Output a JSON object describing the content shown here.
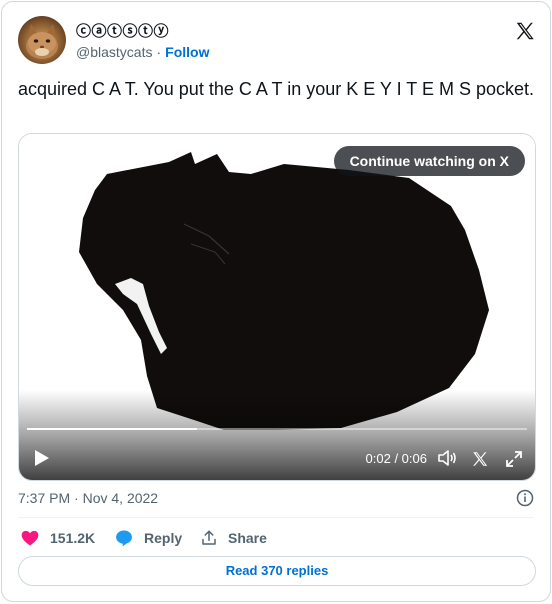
{
  "author": {
    "display_name": "ⓒⓐⓣⓢⓣⓨ",
    "handle": "@blastycats",
    "separator": "·",
    "follow_label": "Follow"
  },
  "tweet": {
    "text": "acquired C A T. You put the C A T in your K E Y  I T E M S pocket."
  },
  "video": {
    "continue_label": "Continue watching on X",
    "time_display": "0:02 / 0:06",
    "progress_fraction": 0.34
  },
  "meta": {
    "time": "7:37 PM",
    "separator": "·",
    "date": "Nov 4, 2022"
  },
  "actions": {
    "likes": "151.2K",
    "reply_label": "Reply",
    "share_label": "Share"
  },
  "read_replies_label": "Read 370 replies",
  "colors": {
    "accent": "#006fd6",
    "like": "#f91880",
    "text_primary": "#0f1419",
    "text_secondary": "#536471",
    "border": "#cfd9de"
  },
  "icons": {
    "logo": "x-logo-icon",
    "play": "play-icon",
    "volume": "volume-icon",
    "x_small": "x-logo-small-icon",
    "expand": "expand-icon",
    "info": "info-icon",
    "like": "heart-icon",
    "reply": "reply-bubble-icon",
    "share": "share-icon"
  }
}
